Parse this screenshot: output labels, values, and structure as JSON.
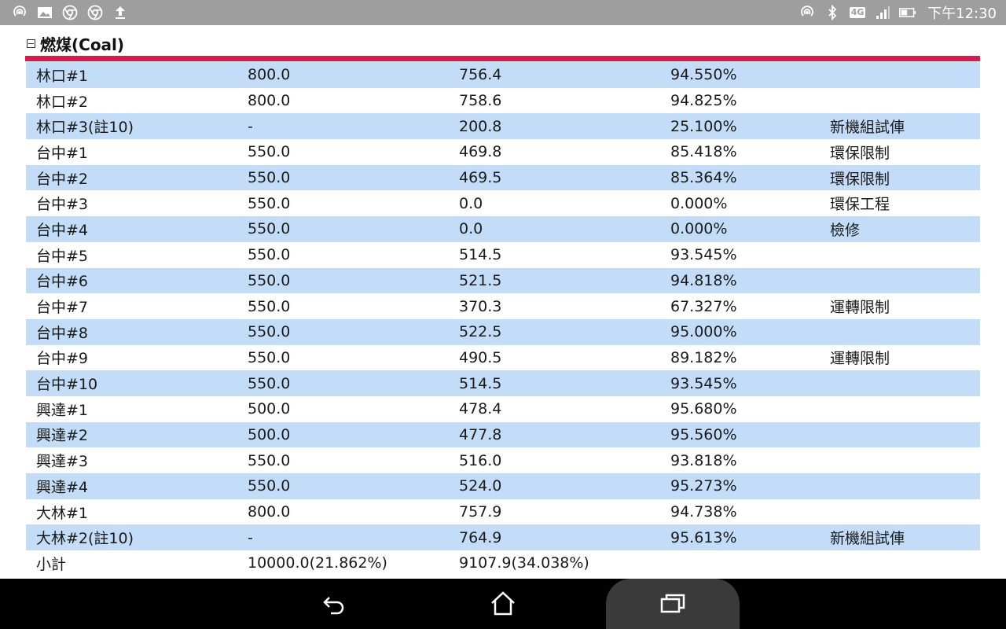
{
  "status_bar": {
    "left_icons": [
      "hotspot-icon",
      "image-icon",
      "chrome-icon",
      "chrome-icon",
      "upload-icon"
    ],
    "right_icons": [
      "hotspot-icon",
      "bluetooth-icon",
      "network-4g-icon",
      "signal-icon",
      "battery-icon"
    ],
    "network_label": "4G",
    "time": "下午12:30"
  },
  "section": {
    "title": "燃煤(Coal)"
  },
  "table": {
    "rows": [
      {
        "unit": "林口#1",
        "capacity": "800.0",
        "output": "756.4",
        "ratio": "94.550%",
        "note": ""
      },
      {
        "unit": "林口#2",
        "capacity": "800.0",
        "output": "758.6",
        "ratio": "94.825%",
        "note": ""
      },
      {
        "unit": "林口#3(註10)",
        "capacity": "-",
        "output": "200.8",
        "ratio": "25.100%",
        "note": "新機組試俥"
      },
      {
        "unit": "台中#1",
        "capacity": "550.0",
        "output": "469.8",
        "ratio": "85.418%",
        "note": "環保限制"
      },
      {
        "unit": "台中#2",
        "capacity": "550.0",
        "output": "469.5",
        "ratio": "85.364%",
        "note": "環保限制"
      },
      {
        "unit": "台中#3",
        "capacity": "550.0",
        "output": "0.0",
        "ratio": "0.000%",
        "note": "環保工程"
      },
      {
        "unit": "台中#4",
        "capacity": "550.0",
        "output": "0.0",
        "ratio": "0.000%",
        "note": "檢修"
      },
      {
        "unit": "台中#5",
        "capacity": "550.0",
        "output": "514.5",
        "ratio": "93.545%",
        "note": ""
      },
      {
        "unit": "台中#6",
        "capacity": "550.0",
        "output": "521.5",
        "ratio": "94.818%",
        "note": ""
      },
      {
        "unit": "台中#7",
        "capacity": "550.0",
        "output": "370.3",
        "ratio": "67.327%",
        "note": "運轉限制"
      },
      {
        "unit": "台中#8",
        "capacity": "550.0",
        "output": "522.5",
        "ratio": "95.000%",
        "note": ""
      },
      {
        "unit": "台中#9",
        "capacity": "550.0",
        "output": "490.5",
        "ratio": "89.182%",
        "note": "運轉限制"
      },
      {
        "unit": "台中#10",
        "capacity": "550.0",
        "output": "514.5",
        "ratio": "93.545%",
        "note": ""
      },
      {
        "unit": "興達#1",
        "capacity": "500.0",
        "output": "478.4",
        "ratio": "95.680%",
        "note": ""
      },
      {
        "unit": "興達#2",
        "capacity": "500.0",
        "output": "477.8",
        "ratio": "95.560%",
        "note": ""
      },
      {
        "unit": "興達#3",
        "capacity": "550.0",
        "output": "516.0",
        "ratio": "93.818%",
        "note": ""
      },
      {
        "unit": "興達#4",
        "capacity": "550.0",
        "output": "524.0",
        "ratio": "95.273%",
        "note": ""
      },
      {
        "unit": "大林#1",
        "capacity": "800.0",
        "output": "757.9",
        "ratio": "94.738%",
        "note": ""
      },
      {
        "unit": "大林#2(註10)",
        "capacity": "-",
        "output": "764.9",
        "ratio": "95.613%",
        "note": "新機組試俥"
      },
      {
        "unit": "小計",
        "capacity": "10000.0(21.862%)",
        "output": "9107.9(34.038%)",
        "ratio": "",
        "note": ""
      }
    ]
  },
  "nav_bar": {
    "buttons": [
      "back-icon",
      "home-icon",
      "recent-apps-icon"
    ]
  },
  "colors": {
    "status_bar_bg": "#9e9e9e",
    "accent_red": "#d81b4a",
    "row_alt_bg": "#c3dcf7",
    "nav_bar_bg": "#000000"
  }
}
